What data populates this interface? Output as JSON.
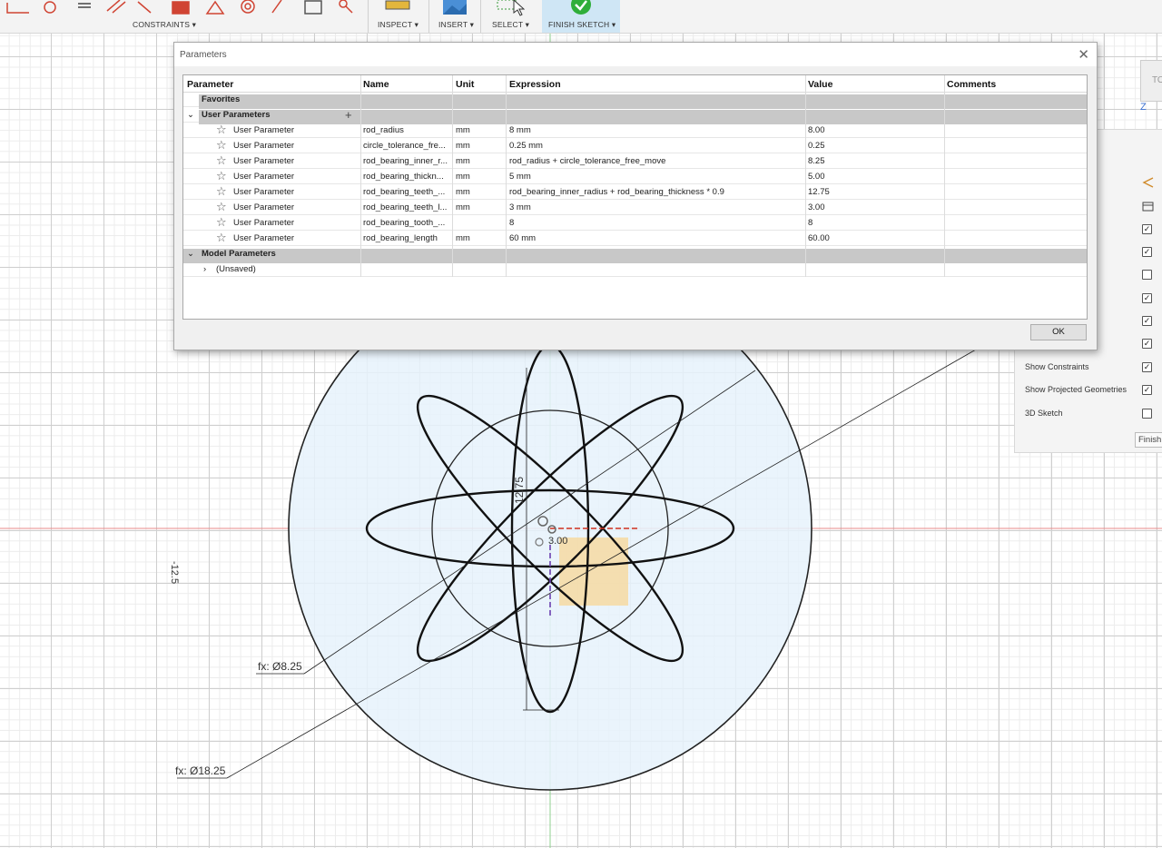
{
  "toolbar": {
    "constraints_label": "CONSTRAINTS ▾",
    "inspect_label": "INSPECT ▾",
    "insert_label": "INSERT ▾",
    "select_label": "SELECT ▾",
    "finish_sketch_label": "FINISH SKETCH ▾"
  },
  "dialog": {
    "title": "Parameters",
    "ok_label": "OK",
    "columns": [
      "Parameter",
      "Name",
      "Unit",
      "Expression",
      "Value",
      "Comments"
    ],
    "groups": {
      "favorites": "Favorites",
      "user": "User Parameters",
      "model": "Model Parameters",
      "unsaved": "(Unsaved)"
    },
    "rows": [
      {
        "parameter": "User Parameter",
        "name": "rod_radius",
        "unit": "mm",
        "expression": "8 mm",
        "value": "8.00"
      },
      {
        "parameter": "User Parameter",
        "name": "circle_tolerance_fre...",
        "unit": "mm",
        "expression": "0.25 mm",
        "value": "0.25"
      },
      {
        "parameter": "User Parameter",
        "name": "rod_bearing_inner_r...",
        "unit": "mm",
        "expression": "rod_radius + circle_tolerance_free_move",
        "value": "8.25"
      },
      {
        "parameter": "User Parameter",
        "name": "rod_bearing_thickn...",
        "unit": "mm",
        "expression": "5 mm",
        "value": "5.00"
      },
      {
        "parameter": "User Parameter",
        "name": "rod_bearing_teeth_...",
        "unit": "mm",
        "expression": "rod_bearing_inner_radius + rod_bearing_thickness * 0.9",
        "value": "12.75"
      },
      {
        "parameter": "User Parameter",
        "name": "rod_bearing_teeth_l...",
        "unit": "mm",
        "expression": "3 mm",
        "value": "3.00"
      },
      {
        "parameter": "User Parameter",
        "name": "rod_bearing_tooth_...",
        "unit": "",
        "expression": "8",
        "value": "8"
      },
      {
        "parameter": "User Parameter",
        "name": "rod_bearing_length",
        "unit": "mm",
        "expression": "60 mm",
        "value": "60.00"
      }
    ]
  },
  "sketch_palette": {
    "show_constraints": "Show Constraints",
    "show_projected": "Show Projected Geometries",
    "sketch_3d": "3D Sketch",
    "finish": "Finish",
    "viewcube_label": "TO",
    "checks": [
      true,
      true,
      false,
      true,
      true,
      true,
      true,
      true,
      false
    ]
  },
  "canvas": {
    "dim_small": "fx: Ø8.25",
    "dim_large": "fx: Ø18.25",
    "dim_vertical": "12.75",
    "dim_side": "-12.5",
    "dim_center": "3.00",
    "axis_z": "Z"
  }
}
